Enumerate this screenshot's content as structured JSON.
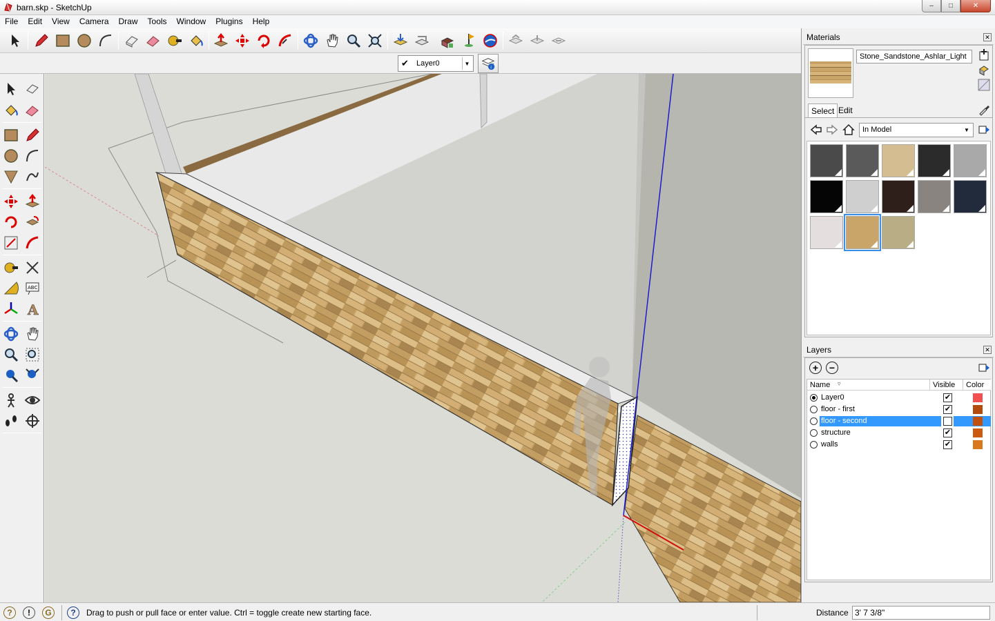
{
  "window": {
    "title": "barn.skp - SketchUp",
    "controls": {
      "minimize": "–",
      "maximize": "□",
      "close": "✕"
    }
  },
  "menu": [
    "File",
    "Edit",
    "View",
    "Camera",
    "Draw",
    "Tools",
    "Window",
    "Plugins",
    "Help"
  ],
  "toolbar": {
    "icons": [
      "select-icon",
      "pencil-icon",
      "rectangle-icon",
      "circle-icon",
      "arc-icon",
      "make-component-icon",
      "eraser-icon",
      "tape-measure-icon",
      "paint-bucket-icon",
      "push-pull-icon",
      "move-icon",
      "rotate-icon",
      "follow-me-icon",
      "orbit-icon",
      "pan-icon",
      "zoom-icon",
      "zoom-extents-icon",
      "get-models-icon",
      "share-model-icon",
      "share-component-icon",
      "photo-textures-icon",
      "add-location-icon",
      "google-earth-icon",
      "dynamic-components-icon",
      "component-options-icon",
      "component-attributes-icon"
    ]
  },
  "layerbar": {
    "current_layer": "Layer0",
    "check": "✔",
    "manager_icon": "layer-manager-icon"
  },
  "materials": {
    "title": "Materials",
    "current_name": "Stone_Sandstone_Ashlar_Light",
    "tabs": [
      "Select",
      "Edit"
    ],
    "active_tab": "Select",
    "collection": "In Model",
    "swatches": [
      {
        "name": "swatch-dark-gray",
        "color": "#4a4a4a"
      },
      {
        "name": "swatch-gray",
        "color": "#5a5a5a"
      },
      {
        "name": "swatch-tan",
        "color": "#d3bd91"
      },
      {
        "name": "swatch-charcoal",
        "color": "#2b2b2b"
      },
      {
        "name": "swatch-light-gray",
        "color": "#a9a9a9"
      },
      {
        "name": "swatch-black",
        "color": "#050505"
      },
      {
        "name": "swatch-concrete",
        "color": "#cfcfcf"
      },
      {
        "name": "swatch-dark-brown",
        "color": "#2f1f1a"
      },
      {
        "name": "swatch-granite",
        "color": "#8a8480"
      },
      {
        "name": "swatch-navy",
        "color": "#212b3b"
      },
      {
        "name": "swatch-marble",
        "color": "#e4dede"
      },
      {
        "name": "swatch-sandstone",
        "color": "#c9a56a"
      },
      {
        "name": "swatch-stone-khaki",
        "color": "#b8ad84"
      }
    ],
    "selected_swatch": 11
  },
  "layers": {
    "title": "Layers",
    "columns": [
      "Name",
      "Visible",
      "Color"
    ],
    "rows": [
      {
        "name": "Layer0",
        "current": true,
        "visible": true,
        "color": "#f25050",
        "selected": false
      },
      {
        "name": "floor - first",
        "current": false,
        "visible": true,
        "color": "#b34a0e",
        "selected": false
      },
      {
        "name": "floor - second",
        "current": false,
        "visible": false,
        "color": "#c0500e",
        "selected": true
      },
      {
        "name": "structure",
        "current": false,
        "visible": true,
        "color": "#cc5a10",
        "selected": false
      },
      {
        "name": "walls",
        "current": false,
        "visible": true,
        "color": "#d87a1c",
        "selected": false
      }
    ]
  },
  "status": {
    "icons": [
      "geo-location-icon",
      "credits-icon",
      "sign-in-icon",
      "help-icon"
    ],
    "help_glyph": "?",
    "message": "Drag to push or pull face or enter value.  Ctrl = toggle create new starting face.",
    "vcb_label": "Distance",
    "vcb_value": "3' 7 3/8\""
  }
}
